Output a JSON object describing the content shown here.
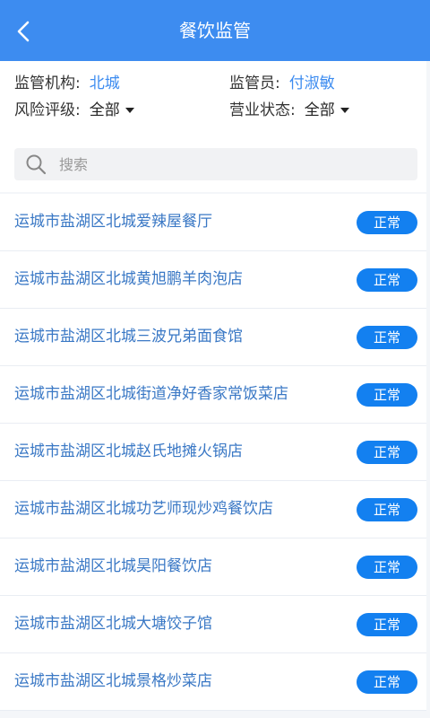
{
  "header": {
    "title": "餐饮监管",
    "back_icon": "chevron-left-icon"
  },
  "filters": {
    "org_label": "监管机构:",
    "org_value": "北城",
    "supervisor_label": "监管员:",
    "supervisor_value": "付淑敏",
    "risk_label": "风险评级:",
    "risk_value": "全部",
    "business_label": "营业状态:",
    "business_value": "全部"
  },
  "search": {
    "placeholder": "搜索",
    "value": ""
  },
  "list": {
    "items": [
      {
        "name": "运城市盐湖区北城爱辣屋餐厅",
        "status": "正常"
      },
      {
        "name": "运城市盐湖区北城黄旭鹏羊肉泡店",
        "status": "正常"
      },
      {
        "name": "运城市盐湖区北城三波兄弟面食馆",
        "status": "正常"
      },
      {
        "name": "运城市盐湖区北城街道净好香家常饭菜店",
        "status": "正常"
      },
      {
        "name": "运城市盐湖区北城赵氏地摊火锅店",
        "status": "正常"
      },
      {
        "name": "运城市盐湖区北城功艺师现炒鸡餐饮店",
        "status": "正常"
      },
      {
        "name": "运城市盐湖区北城昊阳餐饮店",
        "status": "正常"
      },
      {
        "name": "运城市盐湖区北城大塘饺子馆",
        "status": "正常"
      },
      {
        "name": "运城市盐湖区北城景格炒菜店",
        "status": "正常"
      }
    ]
  },
  "colors": {
    "header_bg": "#3d8cf0",
    "badge_bg": "#1380f0",
    "link_text": "#3a78c5"
  }
}
